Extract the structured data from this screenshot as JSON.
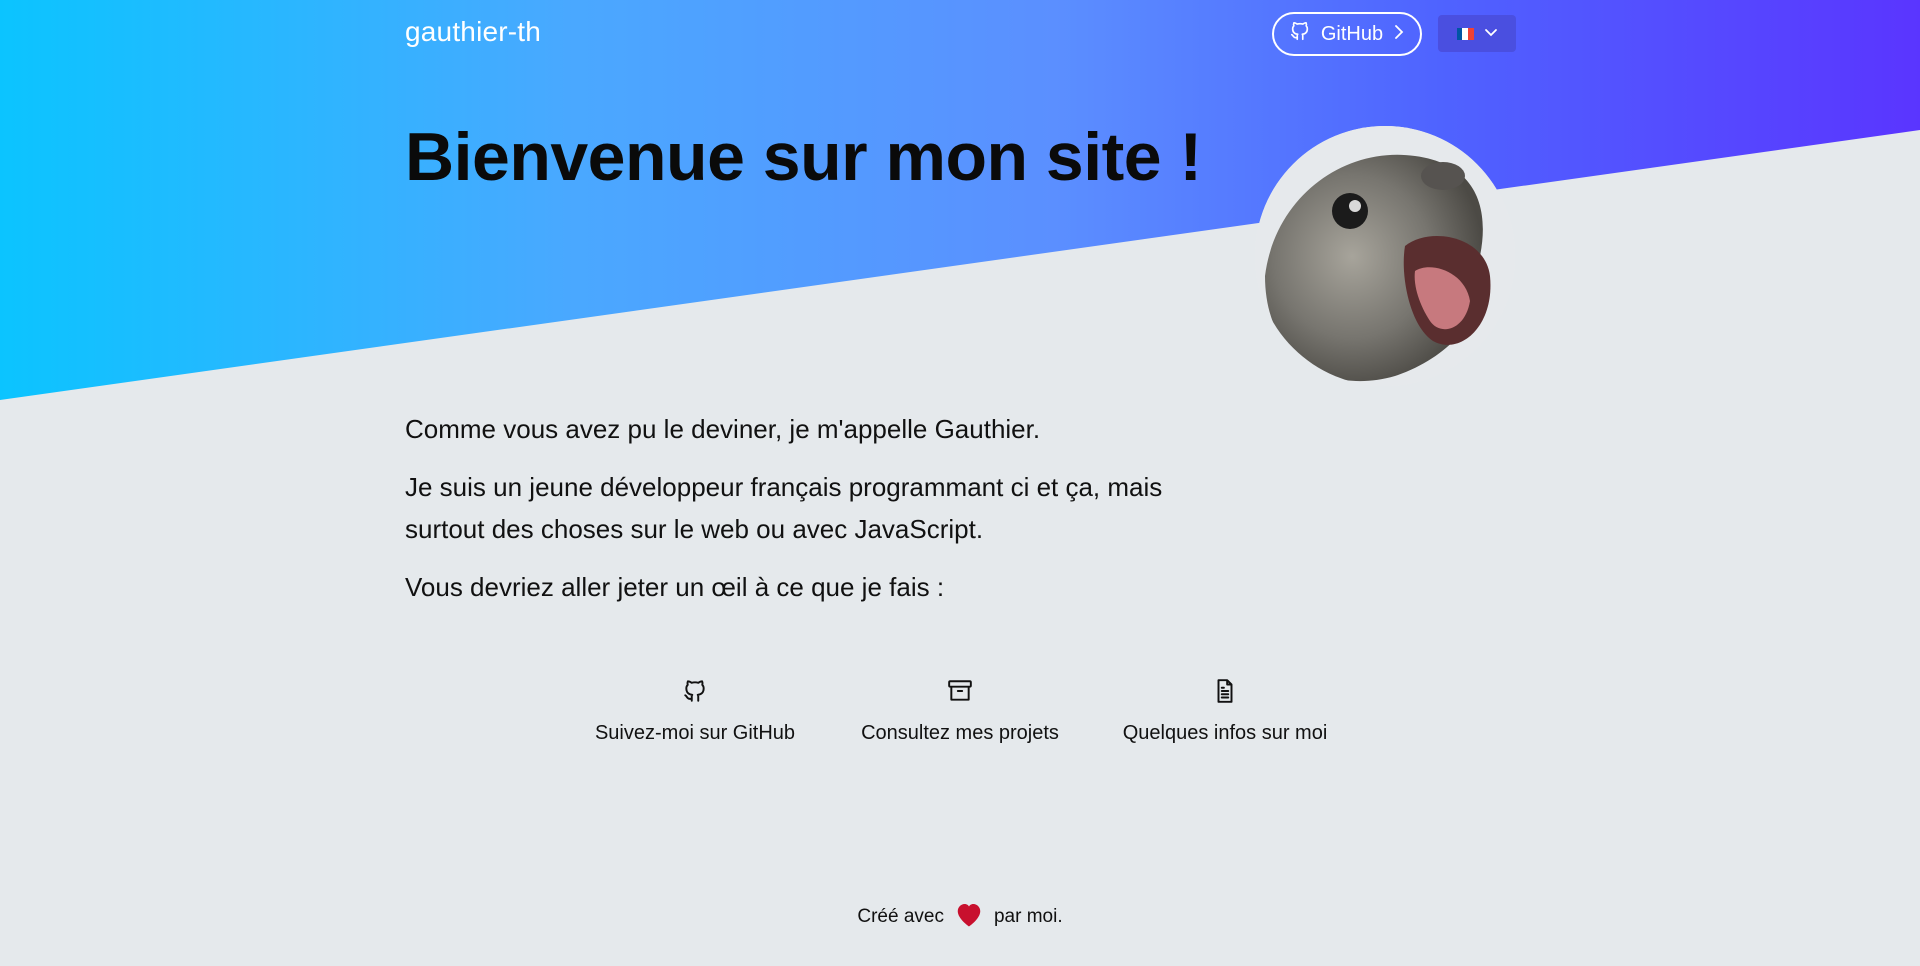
{
  "header": {
    "brand": "gauthier-th",
    "github_button_label": "GitHub",
    "language_flag_colors": [
      "#0055a4",
      "#ffffff",
      "#ef4135"
    ]
  },
  "hero": {
    "title": "Bienvenue sur mon site !",
    "gradient_colors": [
      "#0bc4ff",
      "#4aa8ff",
      "#5b8fff",
      "#4f63ff",
      "#5a35ff"
    ]
  },
  "intro": {
    "paragraphs": [
      "Comme vous avez pu le deviner, je m'appelle Gauthier.",
      "Je suis un jeune développeur français programmant ci et ça, mais surtout des choses sur le web ou avec JavaScript.",
      "Vous devriez aller jeter un œil à ce que je fais :"
    ]
  },
  "links": [
    {
      "icon": "github-icon",
      "label": "Suivez-moi sur GitHub"
    },
    {
      "icon": "archive-icon",
      "label": "Consultez mes projets"
    },
    {
      "icon": "document-icon",
      "label": "Quelques infos sur moi"
    }
  ],
  "footer": {
    "before": "Créé avec",
    "after": "par moi.",
    "heart_color": "#c8102e"
  }
}
